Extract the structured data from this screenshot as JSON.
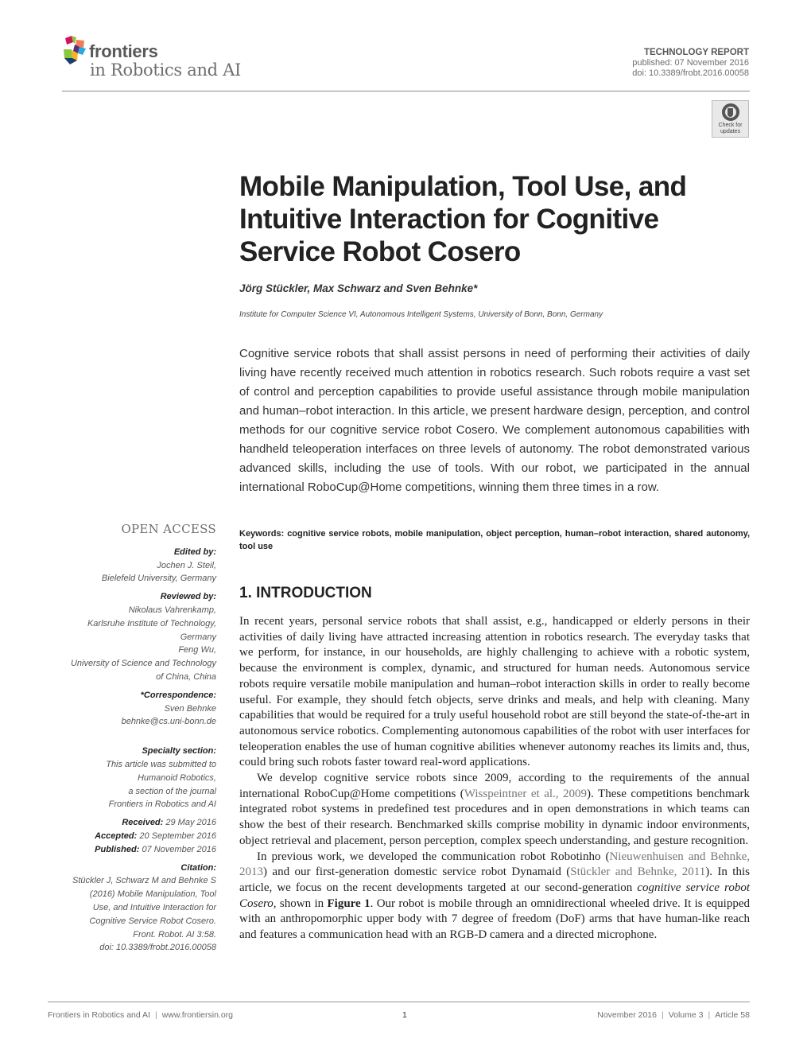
{
  "header": {
    "brand": "frontiers",
    "journal": "in Robotics and AI",
    "article_type": "TECHNOLOGY REPORT",
    "published": "published: 07 November 2016",
    "doi": "doi: 10.3389/frobt.2016.00058",
    "check_updates": [
      "Check for",
      "updates"
    ]
  },
  "title": "Mobile Manipulation, Tool Use, and Intuitive Interaction for Cognitive Service Robot Cosero",
  "authors": "Jörg Stückler, Max Schwarz and Sven Behnke*",
  "affiliation": "Institute for Computer Science VI, Autonomous Intelligent Systems, University of Bonn, Bonn, Germany",
  "abstract": "Cognitive service robots that shall assist persons in need of performing their activities of daily living have recently received much attention in robotics research. Such robots require a vast set of control and perception capabilities to provide useful assistance through mobile manipulation and human–robot interaction. In this article, we present hardware design, perception, and control methods for our cognitive service robot Cosero. We complement autonomous capabilities with handheld teleoperation interfaces on three levels of autonomy. The robot demonstrated various advanced skills, including the use of tools. With our robot, we participated in the annual international RoboCup@Home competitions, winning them three times in a row.",
  "sidebar": {
    "open_access": "OPEN ACCESS",
    "edited_by_label": "Edited by:",
    "edited_by": [
      "Jochen J. Steil,",
      "Bielefeld University, Germany"
    ],
    "reviewed_by_label": "Reviewed by:",
    "reviewed_by": [
      "Nikolaus Vahrenkamp,",
      "Karlsruhe Institute of Technology,",
      "Germany",
      "Feng Wu,",
      "University of Science and Technology",
      "of China, China"
    ],
    "correspondence_label": "*Correspondence:",
    "correspondence": [
      "Sven Behnke",
      "behnke@cs.uni-bonn.de"
    ],
    "specialty_label": "Specialty section:",
    "specialty": [
      "This article was submitted to",
      "Humanoid Robotics,",
      "a section of the journal",
      "Frontiers in Robotics and AI"
    ],
    "received_label": "Received:",
    "received": "29 May 2016",
    "accepted_label": "Accepted:",
    "accepted": "20 September 2016",
    "published_label": "Published:",
    "published": "07 November 2016",
    "citation_label": "Citation:",
    "citation": [
      "Stückler J, Schwarz M and Behnke S",
      "(2016) Mobile Manipulation, Tool",
      "Use, and Intuitive Interaction for",
      "Cognitive Service Robot Cosero.",
      "Front. Robot. AI 3:58.",
      "doi: 10.3389/frobt.2016.00058"
    ]
  },
  "keywords_label": "Keywords:",
  "keywords": "cognitive service robots, mobile manipulation, object perception, human–robot interaction, shared autonomy, tool use",
  "section1": {
    "heading": "1. INTRODUCTION",
    "p1": "In recent years, personal service robots that shall assist, e.g., handicapped or elderly persons in their activities of daily living have attracted increasing attention in robotics research. The everyday tasks that we perform, for instance, in our households, are highly challenging to achieve with a robotic system, because the environment is complex, dynamic, and structured for human needs. Autonomous service robots require versatile mobile manipulation and human–robot interaction skills in order to really become useful. For example, they should fetch objects, serve drinks and meals, and help with cleaning. Many capabilities that would be required for a truly useful household robot are still beyond the state-of-the-art in autonomous service robotics. Complementing autonomous capabilities of the robot with user interfaces for teleoperation enables the use of human cognitive abilities whenever autonomy reaches its limits and, thus, could bring such robots faster toward real-word applications.",
    "p2_a": "We develop cognitive service robots since 2009, according to the requirements of the annual international RoboCup@Home competitions (",
    "p2_ref": "Wisspeintner et al., 2009",
    "p2_b": "). These competitions benchmark integrated robot systems in predefined test procedures and in open demonstrations in which teams can show the best of their research. Benchmarked skills comprise mobility in dynamic indoor environments, object retrieval and placement, person perception, complex speech understanding, and gesture recognition.",
    "p3_a": "In previous work, we developed the communication robot Robotinho (",
    "p3_ref1": "Nieuwenhuisen and Behnke, 2013",
    "p3_b": ") and our first-generation domestic service robot Dynamaid (",
    "p3_ref2": "Stückler and Behnke, 2011",
    "p3_c": "). In this article, we focus on the recent developments targeted at our second-generation ",
    "p3_it": "cognitive service robot Cosero",
    "p3_d": ", shown in ",
    "p3_fig": "Figure 1",
    "p3_e": ". Our robot is mobile through an omnidirectional wheeled drive. It is equipped with an anthropomorphic upper body with 7 degree of freedom (DoF) arms that have human-like reach and features a communication head with an RGB-D camera and a directed microphone."
  },
  "footer": {
    "journal": "Frontiers in Robotics and AI",
    "url": "www.frontiersin.org",
    "page": "1",
    "date": "November 2016",
    "volume": "Volume 3",
    "article": "Article 58"
  }
}
